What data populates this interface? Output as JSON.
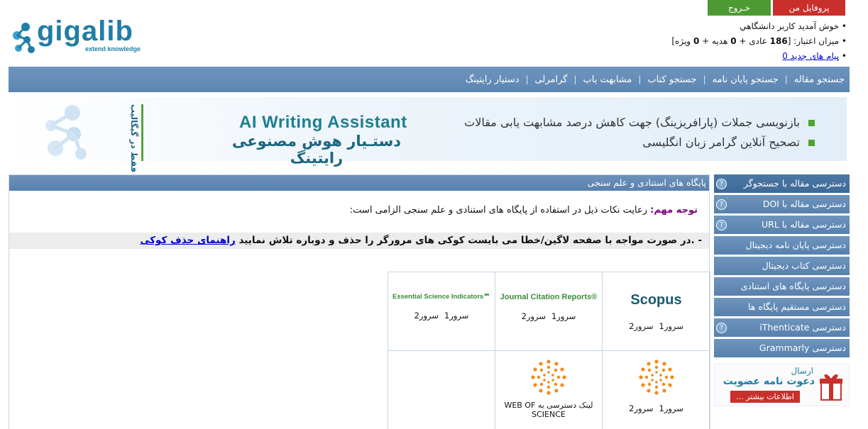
{
  "header": {
    "logo_text": "gigalib",
    "logo_tagline": "extend knowledge",
    "profile_button": "پروفایل من",
    "exit_button": "خـروج",
    "welcome": "خوش آمدید کاربر دانشگاهي",
    "credit_prefix": "میزان اعتبار: [",
    "credit_regular": "186",
    "credit_regular_label": "عادی +",
    "credit_gift": "0",
    "credit_gift_label": "هدیه +",
    "credit_special": "0",
    "credit_special_label": "ویژه]",
    "messages_label": "پیام های جدید 0"
  },
  "nav": {
    "items": [
      "جستجو مقاله",
      "جستجو پایان نامه",
      "جستجو کتاب",
      "مشابهت یاب",
      "گرامرلی",
      "دستیار رایتینگ"
    ]
  },
  "banner": {
    "title_en": "AI Writing Assistant",
    "title_fa": "دستـیار هوش مصنوعی رایتینگ",
    "side_text": "فقط در گیگالیب",
    "feature1": "بازنویسی جملات (پارافریزینگ) جهت کاهش درصد مشابهت یابی مقالات",
    "feature2": "تصحیح آنلاین گرامر زبان انگلیسی"
  },
  "sidebar": {
    "items": [
      {
        "label": "دسترسی مقاله با جستجوگر",
        "help": true
      },
      {
        "label": "دسترسی مقاله با DOI",
        "help": true
      },
      {
        "label": "دسترسی مقاله با URL",
        "help": true
      },
      {
        "label": "دسترسی پایان نامه دیجیتال",
        "help": false
      },
      {
        "label": "دسترسی کتاب دیجیتال",
        "help": false
      },
      {
        "label": "دسترسی پایگاه های استنادی",
        "help": false
      },
      {
        "label": "دسترسی مستقیم پایگاه ها",
        "help": false
      },
      {
        "label": "دسترسی iThenticate",
        "help": true
      },
      {
        "label": "دسترسی Grammarly",
        "help": false
      }
    ],
    "invite_line1": "ارسال",
    "invite_line2": "دعوت نامه عضویت",
    "invite_more": "اطلاعات بیشتر ..."
  },
  "main": {
    "panel_title": "پایگاه های استنادی و علم سنجی",
    "note_label": "توجه مهم:",
    "note_text": "رعایت نکات ذیل در استفاده از پایگاه های استنادی و علم سنجی الزامی است:",
    "alert_text": "- .در صورت مواجه با صفحه لاگین/خطا می بایست کوکی های مرورگر را حذف و دوباره تلاش نمایید",
    "alert_link": "راهنمای حذف کوکی",
    "server1": "سرور1",
    "server2": "سرور2",
    "databases": {
      "scopus": "Scopus",
      "jcr": "Journal Citation Reports®",
      "esi": "Essential Science Indicators℠",
      "wos_link": "لینک دسترسی به  WEB OF SCIENCE"
    }
  },
  "colors": {
    "nav_blue": "#5b85b2",
    "green": "#4e9a32",
    "red": "#c9302c",
    "brand_teal": "#1f7ea6"
  }
}
